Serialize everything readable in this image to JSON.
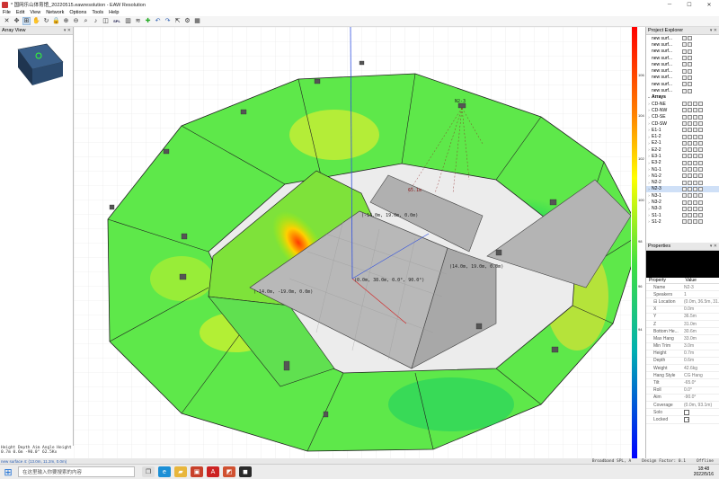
{
  "window": {
    "title": "* 国网乐山体育馆_20220515.eawresolution - EAW Resolution",
    "minimize": "─",
    "maximize": "☐",
    "close": "✕"
  },
  "menu": [
    "File",
    "Edit",
    "View",
    "Network",
    "Options",
    "Tools",
    "Help"
  ],
  "toolbar": {
    "spl_label": "SPL"
  },
  "array_view": {
    "title": "Array View",
    "pin": "▾ ✕"
  },
  "bottom_info": {
    "line1": "Height   Depth  Aim Angle Height",
    "line2": "0.7m     0.6m   -90.0°   62.5Kx"
  },
  "viewport": {
    "label_top": "N2-3",
    "coord1": "(-14.0m, 19.0m, 0.0m)",
    "coord2": "(-14.0m, -19.0m, 0.0m)",
    "coord3": "(14.0m, 19.0m, 0.0m)",
    "coord4": "(0.0m, 38.0m, 0.0°, 90.0°)",
    "dist1": "65.1m"
  },
  "scale": {
    "ticks": [
      "106",
      "104",
      "102",
      "100",
      "98",
      "96",
      "94"
    ]
  },
  "status": {
    "left": "new surface 4: (13.0m, 11.2m, 0.0m)",
    "mode": "Broadband SPL, A",
    "design": "Design Factor: 0.1",
    "offline": "Offline"
  },
  "explorer": {
    "title": "Project Explorer",
    "pin": "▾ ✕",
    "surfaces": [
      "new surf...",
      "new surf...",
      "new surf...",
      "new surf...",
      "new surf...",
      "new surf...",
      "new surf...",
      "new surf...",
      "new surf..."
    ],
    "arrays_label": "Arrays",
    "arrays": [
      "CD-NE",
      "CD-NW",
      "CD-SE",
      "CD-SW",
      "E1-1",
      "E1-2",
      "E2-1",
      "E2-2",
      "E3-1",
      "E3-2",
      "N1-1",
      "N1-2",
      "N2-2",
      "N2-3",
      "N3-1",
      "N3-2",
      "N3-3",
      "S1-1",
      "S1-2"
    ],
    "selected": "N2-3"
  },
  "properties": {
    "title": "Properties",
    "col_property": "Property",
    "col_value": "Value",
    "rows": [
      {
        "k": "Name",
        "v": "N2-3"
      },
      {
        "k": "Speakers",
        "v": "1"
      },
      {
        "k": "⊟ Location",
        "v": "(0.0m, 36.5m, 31.0m)"
      },
      {
        "k": "X",
        "v": "0.0m"
      },
      {
        "k": "Y",
        "v": "36.5m"
      },
      {
        "k": "Z",
        "v": "31.0m"
      },
      {
        "k": "Bottom He...",
        "v": "30.6m"
      },
      {
        "k": "Max Hang",
        "v": "33.0m"
      },
      {
        "k": "Min Trim",
        "v": "3.0m"
      },
      {
        "k": "Height",
        "v": "0.7m"
      },
      {
        "k": "Depth",
        "v": "0.6m"
      },
      {
        "k": "Weight",
        "v": "42.6kg"
      },
      {
        "k": "Hang Style",
        "v": "CG Hang"
      },
      {
        "k": "Tilt",
        "v": "-65.0°"
      },
      {
        "k": "Roll",
        "v": "0.0°"
      },
      {
        "k": "Aim",
        "v": "-90.0°"
      },
      {
        "k": "Coverage",
        "v": "(0.0m, 93.1m)"
      }
    ],
    "solo_label": "Solo",
    "locked_label": "Locked",
    "locked_check": "✓"
  },
  "taskbar": {
    "search_placeholder": "在这里输入你要搜索的内容",
    "time": "18:48",
    "date": "2022/5/16",
    "start_icon": "⊞"
  }
}
